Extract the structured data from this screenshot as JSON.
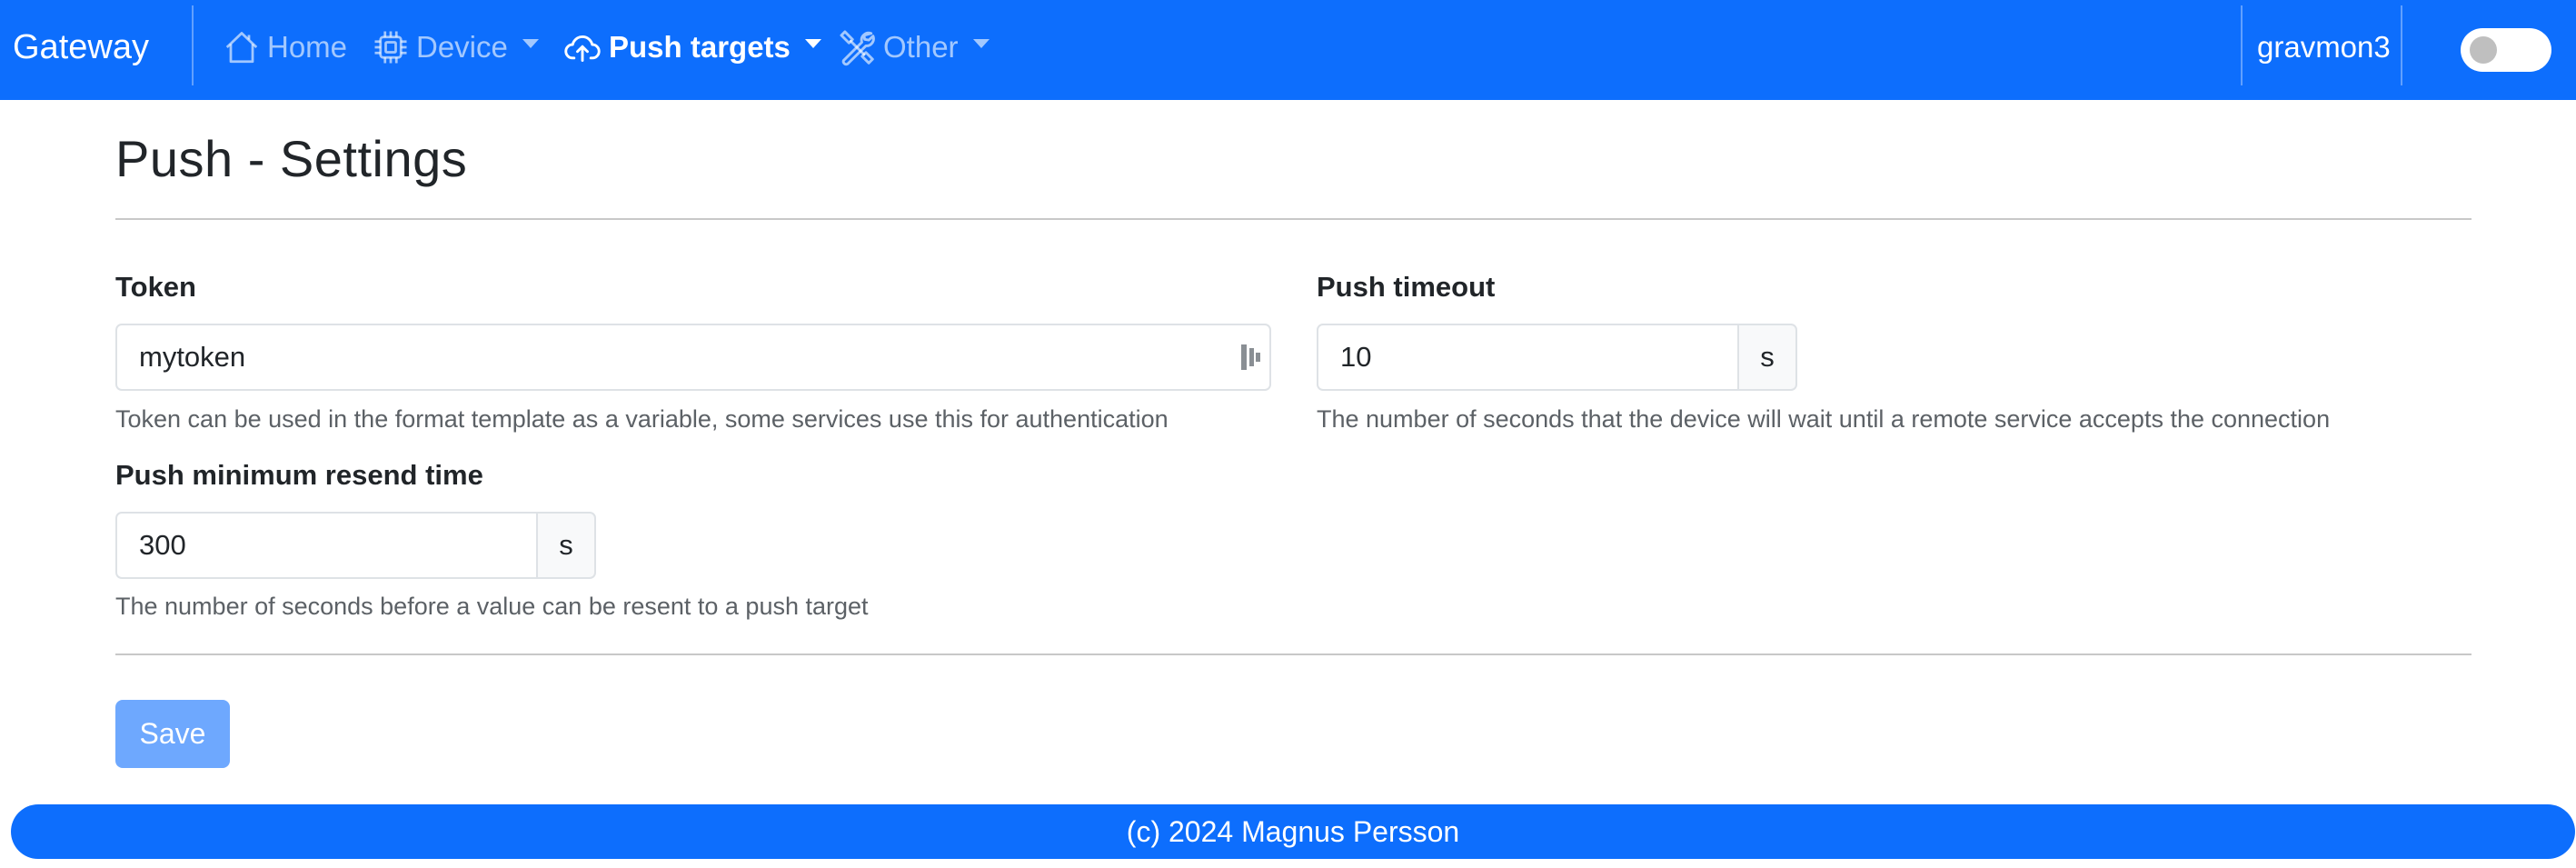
{
  "navbar": {
    "brand": "Gateway",
    "items": [
      {
        "label": "Home",
        "icon": "home-icon",
        "dropdown": false,
        "active": false
      },
      {
        "label": "Device",
        "icon": "chip-icon",
        "dropdown": true,
        "active": false
      },
      {
        "label": "Push targets",
        "icon": "cloud-upload-icon",
        "dropdown": true,
        "active": true
      },
      {
        "label": "Other",
        "icon": "tools-icon",
        "dropdown": true,
        "active": false
      }
    ],
    "user": "gravmon3",
    "theme_toggle": {
      "checked": false
    }
  },
  "page": {
    "title": "Push - Settings"
  },
  "form": {
    "token": {
      "label": "Token",
      "value": "mytoken",
      "help": "Token can be used in the format template as a variable, some services use this for authentication"
    },
    "push_timeout": {
      "label": "Push timeout",
      "value": "10",
      "unit": "s",
      "help": "The number of seconds that the device will wait until a remote service accepts the connection"
    },
    "push_resend": {
      "label": "Push minimum resend time",
      "value": "300",
      "unit": "s",
      "help": "The number of seconds before a value can be resent to a push target"
    },
    "save_label": "Save"
  },
  "footer": {
    "text": "(c) 2024 Magnus Persson"
  },
  "colors": {
    "primary": "#0d6efd",
    "save_disabled": "#6ea8fe"
  }
}
